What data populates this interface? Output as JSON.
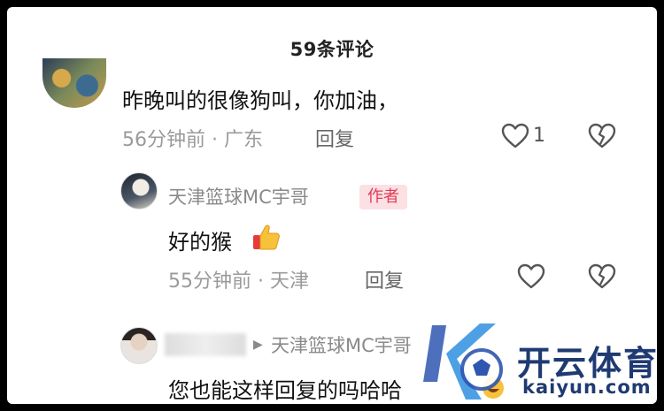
{
  "header": {
    "title": "59条评论"
  },
  "comments": [
    {
      "text": "昨晚叫的很像狗叫，你加油，",
      "time": "56分钟前",
      "location": "广东",
      "reply_label": "回复",
      "like_count": "1"
    }
  ],
  "reply": {
    "username": "天津篮球MC宇哥",
    "author_badge": "作者",
    "text": "好的猴",
    "time": "55分钟前",
    "location": "天津",
    "reply_label": "回复"
  },
  "reply2": {
    "target_username": "天津篮球MC宇哥",
    "text": "您也能这样回复的吗哈哈"
  },
  "watermark": {
    "brand": "开云体育",
    "domain": "kaiyun.com"
  },
  "colors": {
    "author_badge_bg": "#fbe0e4",
    "author_badge_text": "#e23b56",
    "watermark": "#1f3a72"
  },
  "icons": [
    "heart-icon",
    "broken-heart-icon",
    "thumbs-up-emoji",
    "laughing-emoji",
    "triangle-arrow-icon"
  ]
}
